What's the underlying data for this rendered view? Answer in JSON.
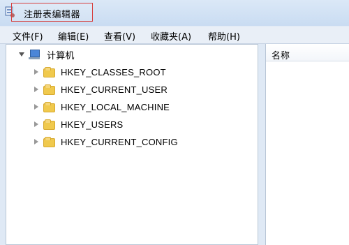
{
  "window": {
    "title": "注册表编辑器"
  },
  "menu": [
    {
      "label": "文件(F)"
    },
    {
      "label": "编辑(E)"
    },
    {
      "label": "查看(V)"
    },
    {
      "label": "收藏夹(A)"
    },
    {
      "label": "帮助(H)"
    }
  ],
  "tree": {
    "root_label": "计算机",
    "items": [
      {
        "label": "HKEY_CLASSES_ROOT"
      },
      {
        "label": "HKEY_CURRENT_USER"
      },
      {
        "label": "HKEY_LOCAL_MACHINE"
      },
      {
        "label": "HKEY_USERS"
      },
      {
        "label": "HKEY_CURRENT_CONFIG"
      }
    ]
  },
  "right_pane": {
    "column_name": "名称"
  }
}
